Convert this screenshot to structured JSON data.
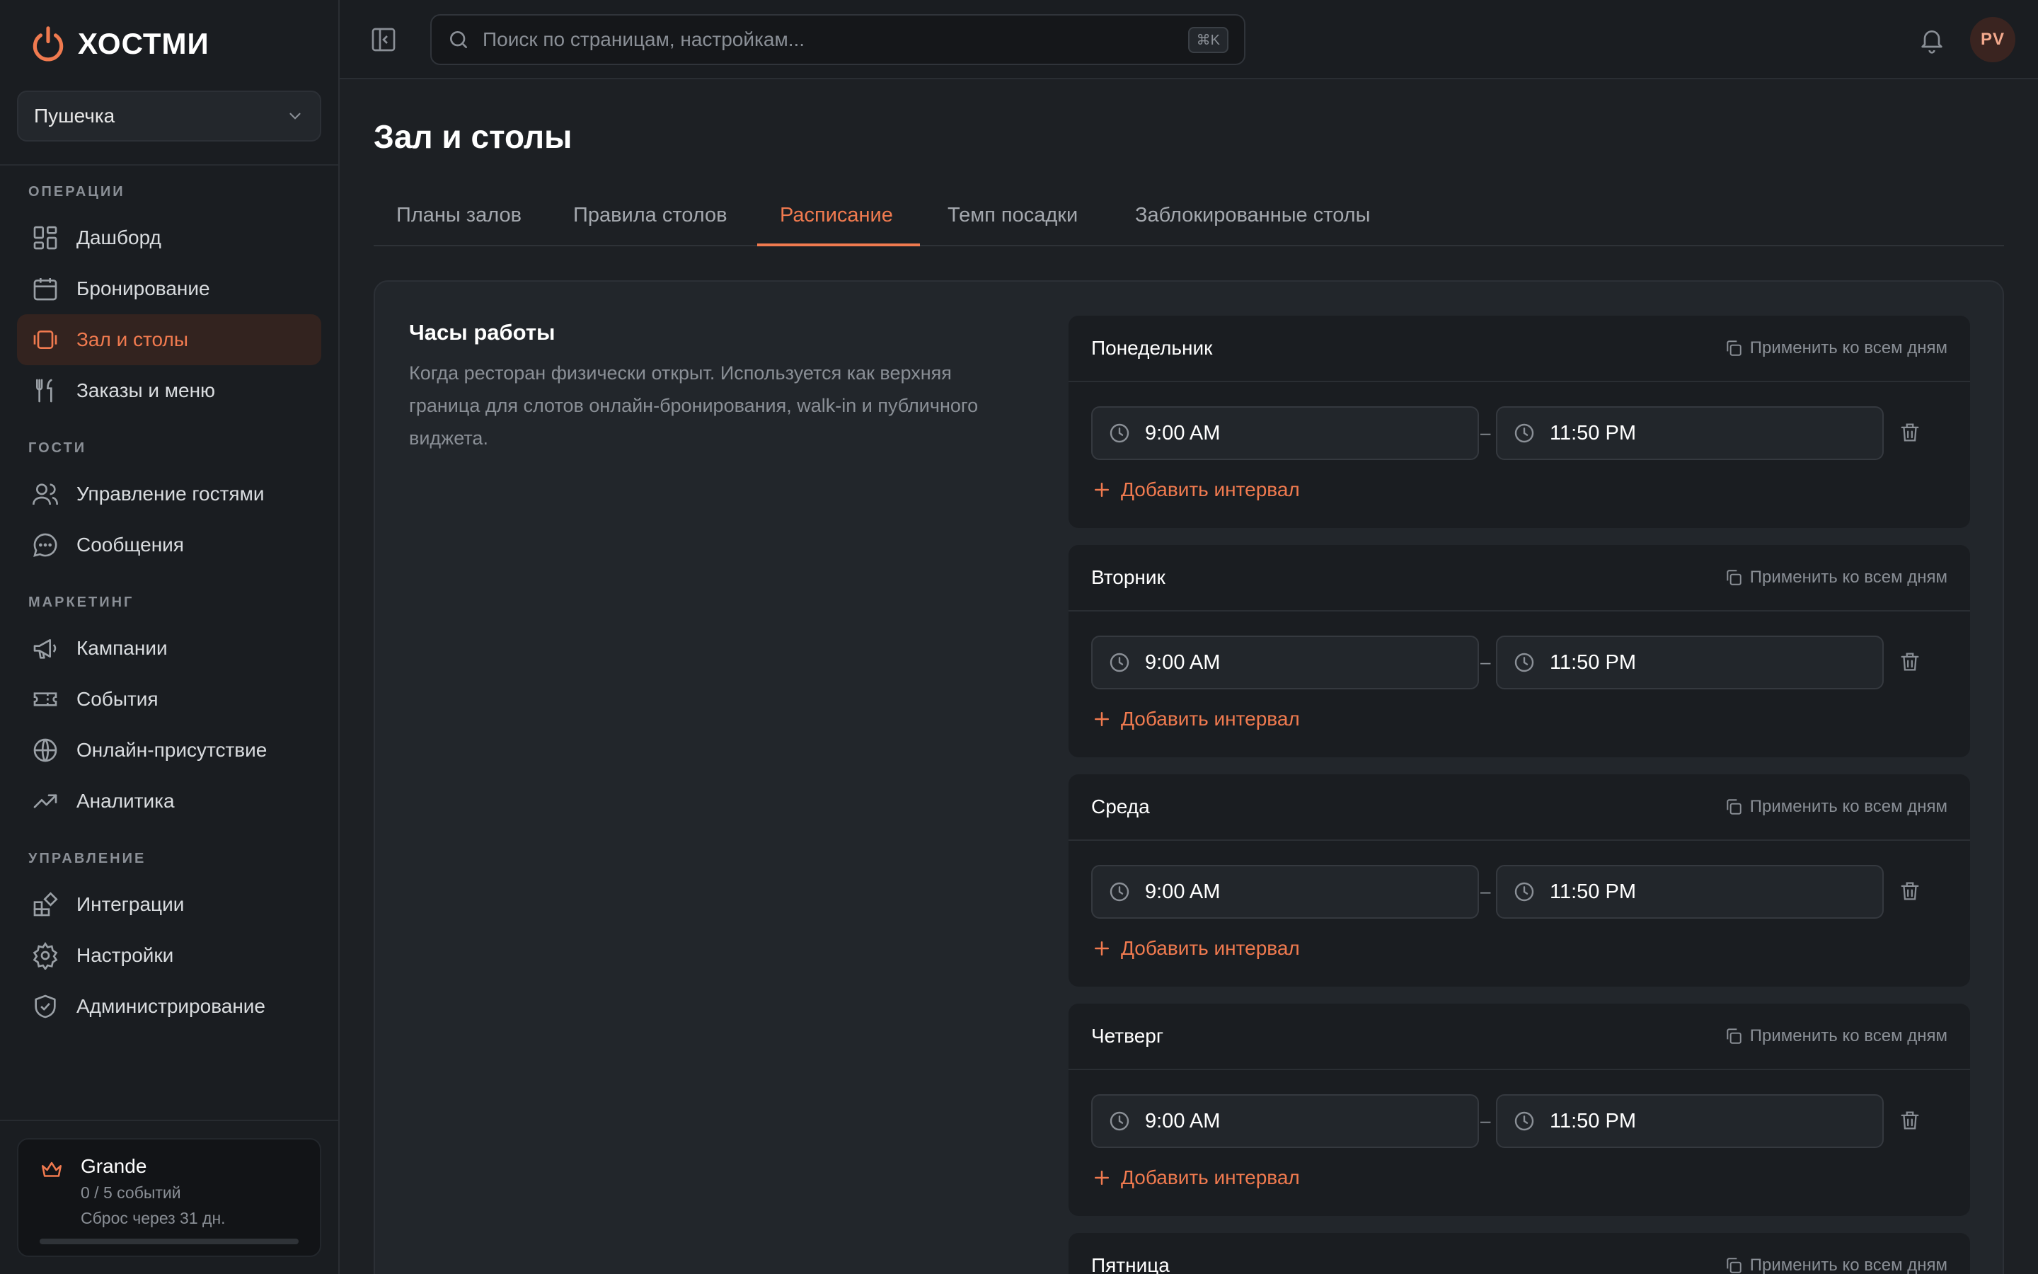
{
  "app": {
    "name": "ХОСТМИ",
    "venue": "Пушечка"
  },
  "colors": {
    "accent": "#f07a4f",
    "background": "#1d2024",
    "sidebar": "#1a1d21"
  },
  "search": {
    "placeholder": "Поиск по страницам, настройкам...",
    "shortcut": "⌘K"
  },
  "user": {
    "initials": "PV"
  },
  "sidebar": {
    "sections": [
      "ОПЕРАЦИИ",
      "ГОСТИ",
      "МАРКЕТИНГ",
      "УПРАВЛЕНИЕ"
    ],
    "items": [
      {
        "label": "Дашборд",
        "icon": "dashboard-icon"
      },
      {
        "label": "Бронирование",
        "icon": "calendar-icon"
      },
      {
        "label": "Зал и столы",
        "icon": "tables-icon",
        "active": true
      },
      {
        "label": "Заказы и меню",
        "icon": "fork-knife-icon"
      },
      {
        "label": "Управление гостями",
        "icon": "users-icon"
      },
      {
        "label": "Сообщения",
        "icon": "chat-icon"
      },
      {
        "label": "Кампании",
        "icon": "megaphone-icon"
      },
      {
        "label": "События",
        "icon": "ticket-icon"
      },
      {
        "label": "Онлайн-присутствие",
        "icon": "globe-icon"
      },
      {
        "label": "Аналитика",
        "icon": "trend-icon"
      },
      {
        "label": "Интеграции",
        "icon": "puzzle-icon"
      },
      {
        "label": "Настройки",
        "icon": "gear-icon"
      },
      {
        "label": "Администрирование",
        "icon": "shield-check-icon"
      }
    ]
  },
  "plan": {
    "name": "Grande",
    "usage": "0 / 5 событий",
    "reset": "Сброс через 31 дн.",
    "progress": 0
  },
  "page": {
    "title": "Зал и столы",
    "tabs": [
      "Планы залов",
      "Правила столов",
      "Расписание",
      "Темп посадки",
      "Заблокированные столы"
    ],
    "active_tab": "Расписание"
  },
  "hours": {
    "title": "Часы работы",
    "description": "Когда ресторан физически открыт. Используется как верхняя граница для слотов онлайн-бронирования, walk-in и публичного виджета.",
    "apply_all_label": "Применить ко всем дням",
    "add_interval_label": "Добавить интервал",
    "days": [
      {
        "name": "Понедельник",
        "start": "9:00 AM",
        "end": "11:50 PM"
      },
      {
        "name": "Вторник",
        "start": "9:00 AM",
        "end": "11:50 PM"
      },
      {
        "name": "Среда",
        "start": "9:00 AM",
        "end": "11:50 PM"
      },
      {
        "name": "Четверг",
        "start": "9:00 AM",
        "end": "11:50 PM"
      },
      {
        "name": "Пятница"
      }
    ]
  }
}
